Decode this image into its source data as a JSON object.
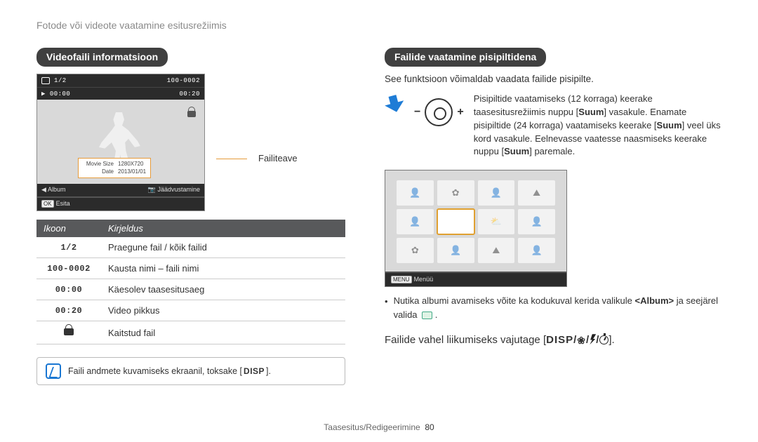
{
  "page_subtitle": "Fotode või videote vaatamine esitusrežiimis",
  "left": {
    "section_title": "Videofaili informatsioon",
    "preview": {
      "counter": "1/2",
      "elapsed": "00:00",
      "folder_file": "100-0002",
      "total": "00:20",
      "info_rows": {
        "movie_size_k": "Movie Size",
        "movie_size_v": "1280X720",
        "date_k": "Date",
        "date_v": "2013/01/01"
      },
      "album_label": "Album",
      "capture_label": "Jäädvustamine",
      "ok_label": "OK",
      "play_label": "Esita"
    },
    "callout_label": "Failiteave",
    "table": {
      "h1": "Ikoon",
      "h2": "Kirjeldus",
      "r1_k": "1/2",
      "r1_v": "Praegune fail / kõik failid",
      "r2_k": "100-0002",
      "r2_v": "Kausta nimi – faili nimi",
      "r3_k": "00:00",
      "r3_v": "Käesolev taasesitusaeg",
      "r4_k": "00:20",
      "r4_v": "Video pikkus",
      "r5_v": "Kaitstud fail"
    },
    "note_pre": "Faili andmete kuvamiseks ekraanil, toksake [",
    "note_btn": "DISP",
    "note_post": "]."
  },
  "right": {
    "section_title": "Failide vaatamine pisipiltidena",
    "intro": "See funktsioon võimaldab vaadata failide pisipilte.",
    "zoom_text_1": "Pisipiltide vaatamiseks (12 korraga) keerake taasesitusrežiimis nuppu ",
    "zoom_text_2": " vasakule. Enamate pisipiltide (24 korraga) vaatamiseks keerake ",
    "zoom_text_3": " veel üks kord vasakule. Eelnevasse vaatesse naasmiseks keerake nuppu ",
    "zoom_text_4": " paremale.",
    "zoom_btn": "Suum",
    "menu_label": "MENU",
    "menu_text": "Menüü",
    "bullet_pre": "Nutika albumi avamiseks võite ka kodukuval kerida valikule ",
    "bullet_bold": "<Album>",
    "bullet_mid": " ja seejärel valida ",
    "nav_pre": "Failide vahel liikumiseks vajutage [",
    "nav_disp": "DISP",
    "nav_post": "]."
  },
  "footer": {
    "section": "Taasesitus/Redigeerimine",
    "page": "80"
  }
}
